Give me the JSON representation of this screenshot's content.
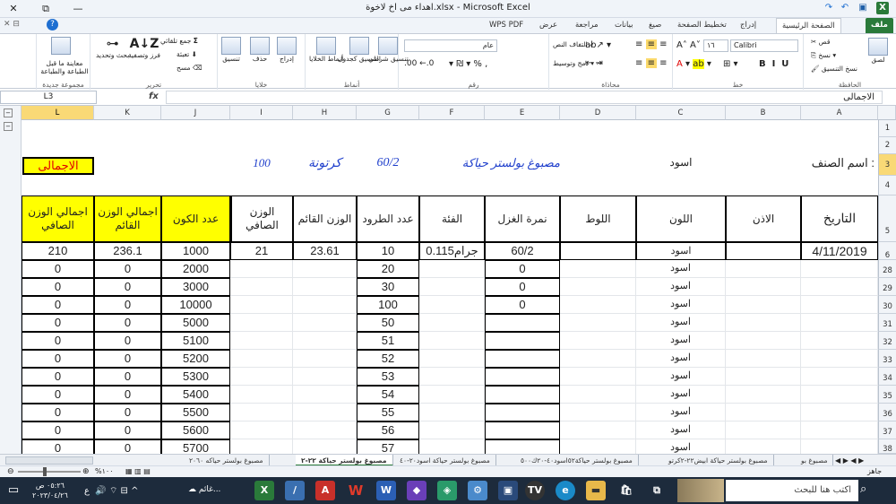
{
  "window": {
    "title": "اهداء مى اخ لاخوة.xlsx - Microsoft Excel",
    "controls": [
      "✕",
      "⧉",
      "—"
    ]
  },
  "tabs": [
    "ملف",
    "الصفحة الرئيسية",
    "إدراج",
    "تخطيط الصفحة",
    "صيغ",
    "بيانات",
    "مراجعة",
    "عرض",
    "WPS PDF"
  ],
  "ribbon": {
    "clipboard": {
      "name": "الحافظة",
      "paste": "لصق",
      "cut": "قص",
      "copy": "نسخ ▾",
      "format_painter": "نسخ التنسيق"
    },
    "font": {
      "name": "خط",
      "family": "Calibri",
      "size": "١٦"
    },
    "alignment": {
      "name": "محاذاة",
      "wrap": "التفاف النص",
      "merge": "دمج وتوسيط ▾"
    },
    "number": {
      "name": "رقم",
      "format": "عام"
    },
    "styles": {
      "name": "أنماط",
      "conditional": "تنسيق شرطي",
      "table": "التنسيق كجدول",
      "cell_styles": "أنماط الخلايا"
    },
    "cells": {
      "name": "خلايا",
      "insert": "إدراج",
      "delete": "حذف",
      "format": "تنسيق"
    },
    "editing": {
      "name": "تحرير",
      "autosum": "جمع تلقائي",
      "fill": "تعبئة",
      "clear": "مسح",
      "sort": "فرز وتصفية",
      "find": "بحث وتحديد"
    },
    "newgroup": {
      "name": "مجموعة جديدة",
      "preview": "معاينة ما قبل الطباعة والطباعة"
    }
  },
  "formula_bar": {
    "name_box": "L3",
    "fx": "fx",
    "content": "الاجمالى"
  },
  "columns": [
    "L",
    "K",
    "J",
    "I",
    "H",
    "G",
    "F",
    "E",
    "D",
    "C",
    "B",
    "A"
  ],
  "rows": [
    "1",
    "2",
    "3",
    "4",
    "5",
    "6",
    "28",
    "29",
    "30",
    "31",
    "32",
    "33",
    "34",
    "35",
    "36",
    "37",
    "38"
  ],
  "sheet": {
    "label_item": "اسم الصنف :",
    "item_color": "اسود",
    "item_desc": "مصبوغ بولستر حياكة",
    "count": "60/2",
    "carton": "كرتونة",
    "hundred": "100",
    "total_label": "الاجمالى",
    "headers": {
      "L": "اجمالي الوزن الصافي",
      "K": "اجمالي الوزن القائم",
      "J": "عدد الكون",
      "I": "الوزن الصافي",
      "H": "الوزن القائم",
      "G": "عدد الطرود",
      "F": "الفئة",
      "E": "نمرة الغزل",
      "D": "اللوط",
      "C": "اللون",
      "B": "الاذن",
      "A": "التاريخ"
    },
    "data_rows": [
      {
        "L": "210",
        "K": "236.1",
        "J": "1000",
        "I": "21",
        "H": "23.61",
        "G": "10",
        "F": "0.115جرام",
        "E": "60/2",
        "C": "اسود",
        "A": "4/11/2019"
      },
      {
        "L": "0",
        "K": "0",
        "J": "2000",
        "G": "20",
        "E": "0",
        "C": "اسود"
      },
      {
        "L": "0",
        "K": "0",
        "J": "3000",
        "G": "30",
        "E": "0",
        "C": "اسود"
      },
      {
        "L": "0",
        "K": "0",
        "J": "10000",
        "G": "100",
        "E": "0",
        "C": "اسود"
      },
      {
        "L": "0",
        "K": "0",
        "J": "5000",
        "G": "50",
        "C": "اسود"
      },
      {
        "L": "0",
        "K": "0",
        "J": "5100",
        "G": "51",
        "C": "اسود"
      },
      {
        "L": "0",
        "K": "0",
        "J": "5200",
        "G": "52",
        "C": "اسود"
      },
      {
        "L": "0",
        "K": "0",
        "J": "5300",
        "G": "53",
        "C": "اسود"
      },
      {
        "L": "0",
        "K": "0",
        "J": "5400",
        "G": "54",
        "C": "اسود"
      },
      {
        "L": "0",
        "K": "0",
        "J": "5500",
        "G": "55",
        "C": "اسود"
      },
      {
        "L": "0",
        "K": "0",
        "J": "5600",
        "G": "56",
        "C": "اسود"
      },
      {
        "L": "0",
        "K": "0",
        "J": "5700",
        "G": "57",
        "C": "اسود"
      }
    ]
  },
  "sheet_tabs": [
    "مصبوغ بولستر حياكه ٢٠٦٠",
    "مصبوغ بولستر حياكة ٢٢-٢",
    "مصبوغ بولستر حياكة اسود٢٠-٤٠",
    "مصبوغ بولستر حياكة٥٢اسود٤٠-٢٠ك٥٠٠",
    "مصبوغ بولستر حياكة ابيض٢٢-٢كرتو",
    "مصبوغ بو"
  ],
  "status": {
    "ready": "جاهز",
    "zoom": "%١٠٠"
  },
  "taskbar": {
    "search": "اكتب هنا للبحث",
    "time": "٠٥:٢٦ ص",
    "date": "٢٠٢٣/٠٤/٢٦",
    "app_label": "غائم..."
  },
  "colors": {
    "excel_green": "#2a7a3a",
    "header_yellow": "#ffff00",
    "text_blue": "#1f3fcc",
    "total_red": "#e00000"
  }
}
